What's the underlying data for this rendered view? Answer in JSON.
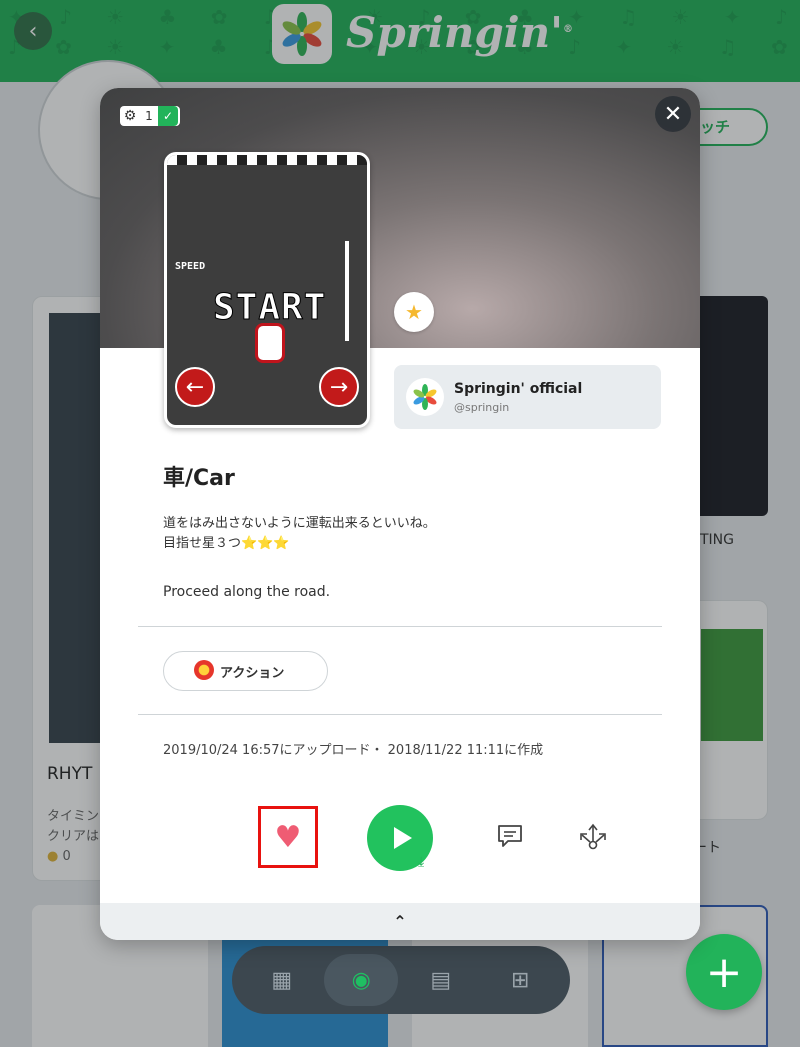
{
  "header": {
    "app_name": "Springin'",
    "trademark": "®",
    "back_icon": "chevron-left-icon"
  },
  "background": {
    "follow_button_label": "ッチ",
    "left_card": {
      "title": "RHYT",
      "subtitle_lines": [
        "タイミン",
        "クリアは"
      ],
      "coins": "0"
    },
    "right_card_title": "TING",
    "right_card2_title": "ート"
  },
  "modal": {
    "setting_count": "1",
    "close_icon": "close-icon",
    "preview": {
      "speed_label": "SPEED",
      "start_label": "START"
    },
    "author": {
      "name": "Springin' official",
      "handle": "@springin"
    },
    "title": "車/Car",
    "description_ja": "道をはみ出さないように運転出来るといいね。\n目指せ星３つ⭐⭐⭐",
    "description_en": "Proceed along the road.",
    "tag_label": "アクション",
    "dates": "2019/10/24 16:57にアップロード・ 2018/11/22 11:11に作成",
    "actions": {
      "like_icon": "heart-icon",
      "play_icon": "play-icon",
      "download_icon": "download-icon",
      "comment_icon": "comment-icon",
      "share_icon": "share-icon"
    },
    "footer_icon": "chevron-up-icon"
  },
  "dock": {
    "items": [
      "calculator-icon",
      "search-icon",
      "notebook-icon",
      "folder-add-icon"
    ]
  },
  "colors": {
    "brand_green": "#22b35a",
    "highlight_red": "#e8120f",
    "heart_pink": "#ef5c73"
  }
}
